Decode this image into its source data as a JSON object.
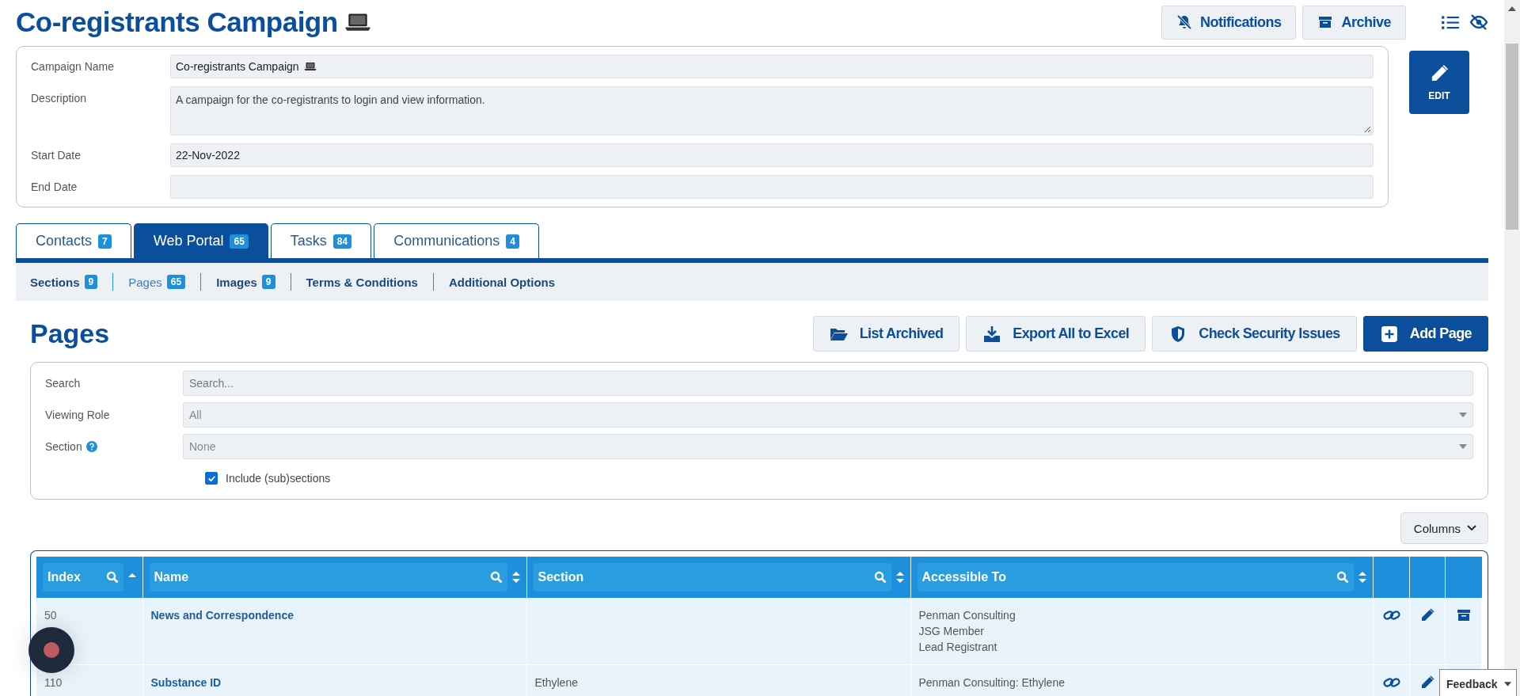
{
  "title": "Co-registrants Campaign",
  "header_buttons": [
    {
      "label": "Notifications",
      "kind": "bell-off"
    },
    {
      "label": "Archive",
      "kind": "archive"
    }
  ],
  "edit_button": "EDIT",
  "campaign_fields": [
    {
      "label": "Campaign Name",
      "value": "Co-registrants Campaign",
      "kind": "input",
      "laptop": true
    },
    {
      "label": "Description",
      "value": "A campaign for the co-registrants to login and view information.",
      "kind": "textarea",
      "laptop": false
    },
    {
      "label": "Start Date",
      "value": "22-Nov-2022",
      "kind": "input",
      "laptop": false
    },
    {
      "label": "End Date",
      "kind": "input",
      "laptop": false
    }
  ],
  "tabs": [
    {
      "label": "Contacts",
      "count": "7",
      "selected": false
    },
    {
      "label": "Web Portal",
      "count": "65",
      "selected": true
    },
    {
      "label": "Tasks",
      "count": "84",
      "selected": false
    },
    {
      "label": "Communications",
      "count": "4",
      "selected": false
    }
  ],
  "subtabs": [
    {
      "label": "Sections",
      "count": "9",
      "selected": false
    },
    {
      "label": "Pages",
      "count": "65",
      "selected": true
    },
    {
      "label": "Images",
      "count": "9",
      "selected": false
    },
    {
      "label": "Terms & Conditions",
      "selected": false
    },
    {
      "label": "Additional Options",
      "selected": false
    }
  ],
  "pages_title": "Pages",
  "actions": [
    {
      "label": "List Archived",
      "kind": "folder",
      "primary": false
    },
    {
      "label": "Export All to Excel",
      "kind": "download",
      "primary": false
    },
    {
      "label": "Check Security Issues",
      "kind": "shield",
      "primary": false
    },
    {
      "label": "Add Page",
      "kind": "plus",
      "primary": true
    }
  ],
  "filters": [
    {
      "label": "Search",
      "placeholder": "Search...",
      "kind": "text",
      "help": false
    },
    {
      "label": "Viewing Role",
      "value": "All",
      "kind": "select",
      "help": false
    },
    {
      "label": "Section",
      "value": "None",
      "kind": "select",
      "help": true
    }
  ],
  "include_subsections": {
    "label": "Include (sub)sections",
    "checked": true
  },
  "columns_button": "Columns",
  "table": {
    "columns": [
      {
        "label": "Index",
        "sorted": true
      },
      {
        "label": "Name",
        "sorted": false
      },
      {
        "label": "Section",
        "sorted": false
      },
      {
        "label": "Accessible To",
        "sorted": false
      }
    ],
    "rows": [
      {
        "index": "50",
        "name": "News and Correspondence",
        "accessible_to": [
          "Penman Consulting",
          "JSG Member",
          "Lead Registrant"
        ],
        "archive": true
      },
      {
        "index": "110",
        "name": "Substance ID",
        "section": "Ethylene",
        "accessible_to": [
          "Penman Consulting: Ethylene"
        ]
      }
    ]
  },
  "feedback": "Feedback"
}
